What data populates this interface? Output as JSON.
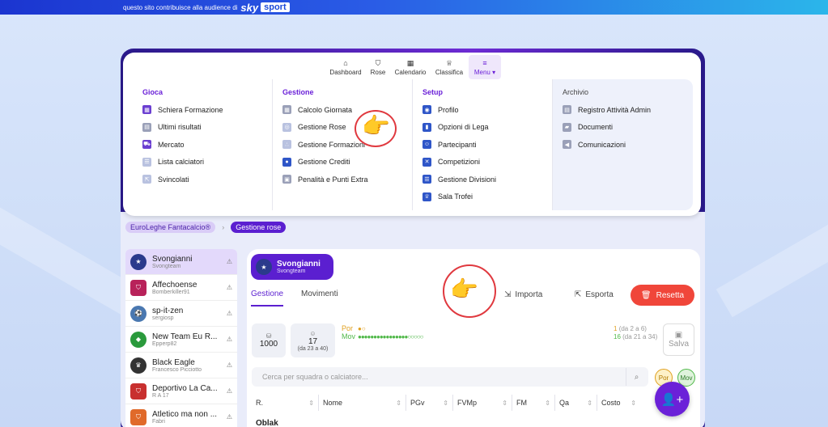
{
  "banner": {
    "text": "questo sito contribuisce alla audience di",
    "brand1": "sky",
    "brand2": "sport"
  },
  "topnav": [
    {
      "label": "Dashboard",
      "icon": "home-icon"
    },
    {
      "label": "Rose",
      "icon": "shield-icon"
    },
    {
      "label": "Calendario",
      "icon": "calendar-icon"
    },
    {
      "label": "Classifica",
      "icon": "trophy-icon"
    },
    {
      "label": "Menu",
      "icon": "menu-icon"
    }
  ],
  "menu": {
    "gioca": {
      "title": "Gioca",
      "items": [
        "Schiera Formazione",
        "Ultimi risultati",
        "Mercato",
        "Lista calciatori",
        "Svincolati"
      ]
    },
    "gestione": {
      "title": "Gestione",
      "items": [
        "Calcolo Giornata",
        "Gestione Rose",
        "Gestione Formazioni",
        "Gestione Crediti",
        "Penalità e Punti Extra"
      ]
    },
    "setup": {
      "title": "Setup",
      "items": [
        "Profilo",
        "Opzioni di Lega",
        "Partecipanti",
        "Competizioni",
        "Gestione Divisioni",
        "Sala Trofei"
      ]
    },
    "archivio": {
      "title": "Archivio",
      "items": [
        "Registro Attività Admin",
        "Documenti",
        "Comunicazioni"
      ]
    }
  },
  "breadcrumb": [
    "EuroLeghe Fantacalcio®",
    "Gestione rose"
  ],
  "teams": [
    {
      "name": "Svongianni",
      "owner": "Svongteam"
    },
    {
      "name": "Affechoense",
      "owner": "Bomberkiller91"
    },
    {
      "name": "sp-it-zen",
      "owner": "sergiosp"
    },
    {
      "name": "New Team Eu R...",
      "owner": "Epperp82"
    },
    {
      "name": "Black Eagle",
      "owner": "Francesco Picciotto"
    },
    {
      "name": "Deportivo La Ca...",
      "owner": "R A 17"
    },
    {
      "name": "Atletico ma non ...",
      "owner": "Fabri"
    }
  ],
  "selected_team": {
    "name": "Svongianni",
    "owner": "Svongteam"
  },
  "tabs": [
    "Gestione",
    "Movimenti"
  ],
  "actions": {
    "import": "Importa",
    "export": "Esporta",
    "reset": "Resetta",
    "save": "Salva"
  },
  "stats": {
    "credits": "1000",
    "players": "17",
    "players_range": "(da 23 a 40)"
  },
  "roles": {
    "por_label": "Por",
    "por_count": "1",
    "por_range": "(da 2 a 6)",
    "mov_label": "Mov",
    "mov_count": "16",
    "mov_range": "(da 21 a 34)"
  },
  "search": {
    "placeholder": "Cerca per squadra o calciatore..."
  },
  "filters": [
    "Por",
    "Mov"
  ],
  "columns": [
    "R.",
    "Nome",
    "PGv",
    "FVMp",
    "FM",
    "Qa",
    "Costo"
  ],
  "first_row": {
    "name": "Oblak"
  },
  "colors": {
    "accent": "#5b1fd0",
    "danger": "#f0463a",
    "success": "#4fb848"
  }
}
